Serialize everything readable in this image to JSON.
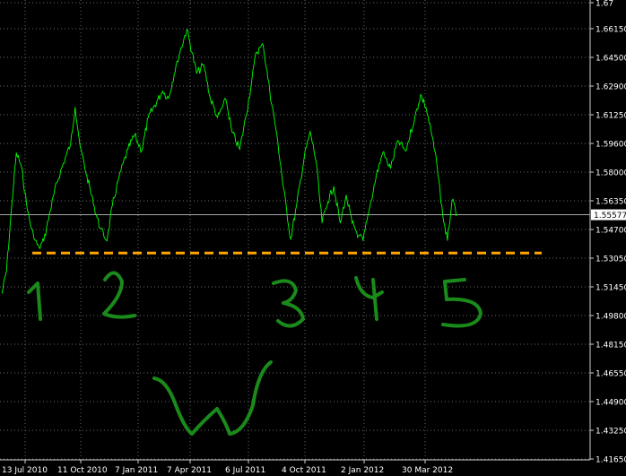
{
  "colors": {
    "background": "#000000",
    "grid": "#6a6a6a",
    "axis": "#cfcfcf",
    "price_line": "#00ff00",
    "support_line": "#ffa500",
    "annotation": "#1a8a1a",
    "label_text": "#ffffff",
    "current_price_line": "#bfbfbf"
  },
  "chart_data": {
    "type": "line",
    "x_tick_labels": [
      "13 Jul 2010",
      "11 Oct 2010",
      "7 Jan 2011",
      "7 Apr 2011",
      "6 Jul 2011",
      "4 Oct 2011",
      "2 Jan 2012",
      "30 Mar 2012"
    ],
    "y_tick_labels": [
      "1.67",
      "1.66150",
      "1.64500",
      "1.62900",
      "1.61250",
      "1.59600",
      "1.58000",
      "1.56350",
      "1.54700",
      "1.53050",
      "1.51450",
      "1.49800",
      "1.48150",
      "1.46550",
      "1.44900",
      "1.43250",
      "1.41650"
    ],
    "ylim": [
      1.41,
      1.67
    ],
    "grid": true,
    "current_price": "1.55577",
    "support_level": 1.534,
    "series": [
      {
        "x": [
          "2010-06-28",
          "2010-07-05",
          "2010-07-13",
          "2010-07-20",
          "2010-07-28",
          "2010-08-06",
          "2010-08-16",
          "2010-08-24",
          "2010-08-31",
          "2010-09-10",
          "2010-09-20",
          "2010-09-30",
          "2010-10-11",
          "2010-10-18",
          "2010-10-26",
          "2010-11-05",
          "2010-11-15",
          "2010-11-25",
          "2010-12-06",
          "2010-12-14",
          "2010-12-24",
          "2011-01-07",
          "2011-01-17",
          "2011-01-28",
          "2011-02-07",
          "2011-02-17",
          "2011-03-01",
          "2011-03-10",
          "2011-03-23",
          "2011-04-07",
          "2011-04-15",
          "2011-04-22",
          "2011-05-03",
          "2011-05-13",
          "2011-05-24",
          "2011-06-06",
          "2011-06-15",
          "2011-06-27",
          "2011-07-06",
          "2011-07-14",
          "2011-07-22",
          "2011-08-02",
          "2011-08-12",
          "2011-08-23",
          "2011-09-02",
          "2011-09-13",
          "2011-09-22",
          "2011-10-04",
          "2011-10-13",
          "2011-10-22",
          "2011-10-31",
          "2011-11-09",
          "2011-11-18",
          "2011-11-28",
          "2011-12-07",
          "2011-12-16",
          "2011-12-26",
          "2012-01-02",
          "2012-01-11",
          "2012-01-22",
          "2012-02-01",
          "2012-02-13",
          "2012-02-24",
          "2012-03-07",
          "2012-03-21",
          "2012-03-30",
          "2012-04-07",
          "2012-04-15",
          "2012-04-24",
          "2012-05-03",
          "2012-05-10",
          "2012-05-17",
          "2012-05-25"
        ],
        "values": [
          1.511,
          1.524,
          1.561,
          1.591,
          1.583,
          1.558,
          1.542,
          1.537,
          1.541,
          1.558,
          1.574,
          1.585,
          1.596,
          1.617,
          1.594,
          1.578,
          1.562,
          1.548,
          1.541,
          1.561,
          1.577,
          1.593,
          1.601,
          1.592,
          1.611,
          1.618,
          1.626,
          1.622,
          1.643,
          1.661,
          1.648,
          1.636,
          1.641,
          1.622,
          1.611,
          1.621,
          1.603,
          1.593,
          1.611,
          1.628,
          1.648,
          1.652,
          1.626,
          1.601,
          1.571,
          1.542,
          1.561,
          1.589,
          1.603,
          1.586,
          1.551,
          1.563,
          1.572,
          1.551,
          1.567,
          1.551,
          1.544,
          1.541,
          1.558,
          1.578,
          1.591,
          1.582,
          1.598,
          1.592,
          1.611,
          1.624,
          1.617,
          1.603,
          1.584,
          1.555,
          1.541,
          1.564,
          1.556
        ]
      }
    ]
  },
  "annotations": {
    "labels": [
      "1",
      "2",
      "3",
      "4",
      "5"
    ],
    "pattern_letter": "W"
  }
}
